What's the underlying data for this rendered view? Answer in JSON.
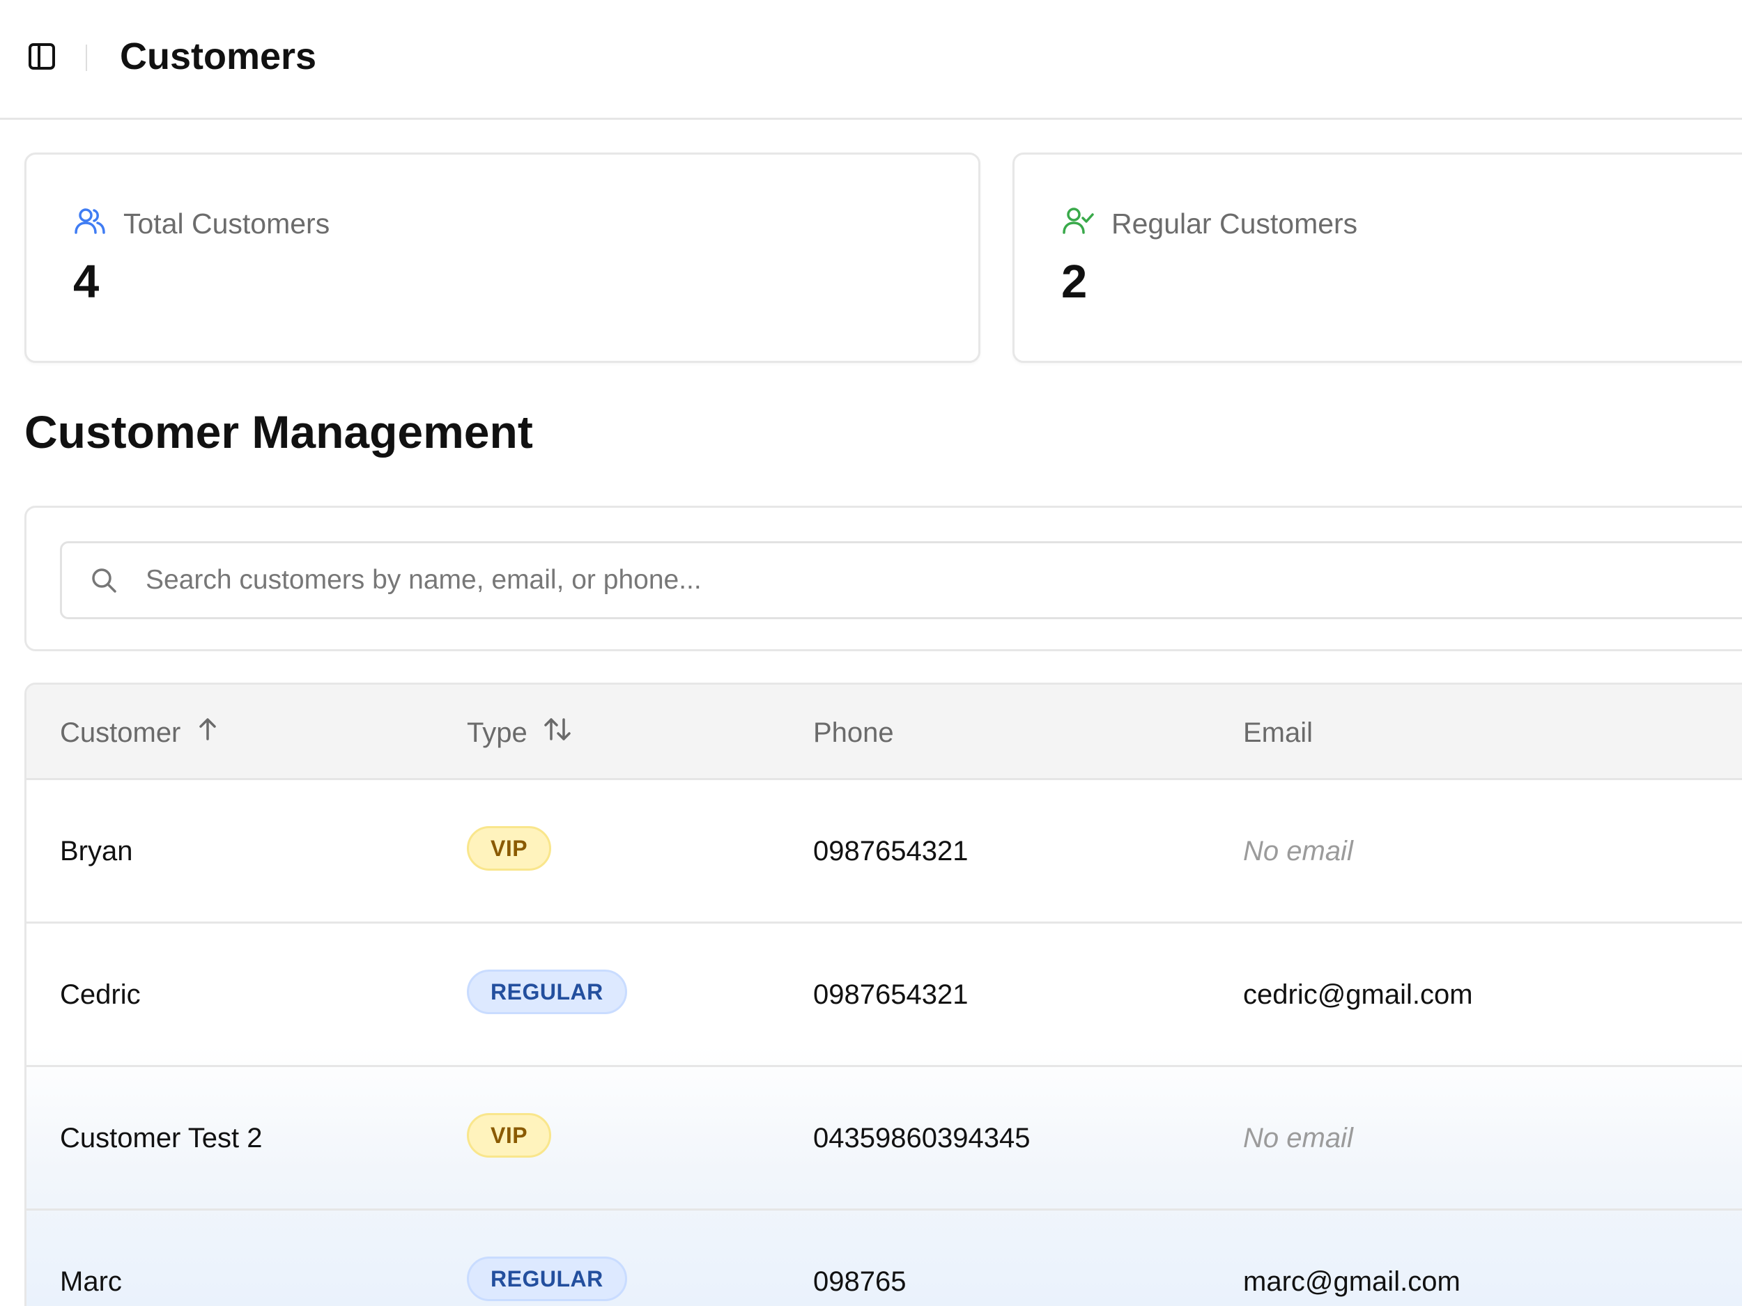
{
  "header": {
    "title": "Customers",
    "sidebar_toggle_icon": "sidebar-panel-icon"
  },
  "stats": {
    "total": {
      "label": "Total Customers",
      "value": "4",
      "icon": "users-icon",
      "icon_color": "#3f7cf3"
    },
    "regular": {
      "label": "Regular Customers",
      "value": "2",
      "icon": "user-check-icon",
      "icon_color": "#39a94a"
    }
  },
  "section": {
    "title": "Customer Management"
  },
  "search": {
    "placeholder": "Search customers by name, email, or phone...",
    "value": "",
    "icon": "search-icon"
  },
  "table": {
    "columns": {
      "customer": {
        "label": "Customer",
        "sort_icon": "arrow-up-icon"
      },
      "type": {
        "label": "Type",
        "sort_icon": "sort-icon"
      },
      "phone": {
        "label": "Phone"
      },
      "email": {
        "label": "Email"
      }
    },
    "rows": [
      {
        "customer": "Bryan",
        "type": "VIP",
        "phone": "0987654321",
        "email": "No email"
      },
      {
        "customer": "Cedric",
        "type": "REGULAR",
        "phone": "0987654321",
        "email": "cedric@gmail.com"
      },
      {
        "customer": "Customer Test 2",
        "type": "VIP",
        "phone": "04359860394345",
        "email": "No email"
      },
      {
        "customer": "Marc",
        "type": "REGULAR",
        "phone": "098765",
        "email": "marc@gmail.com"
      }
    ]
  },
  "colors": {
    "vip_background": "#fff3bd",
    "vip_text": "#8a5a00",
    "regular_background": "#dde9ff",
    "regular_text": "#234f9e"
  }
}
